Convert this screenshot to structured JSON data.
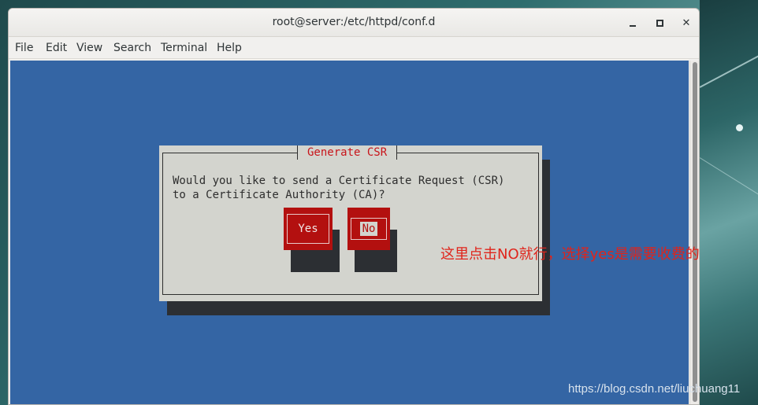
{
  "window": {
    "title": "root@server:/etc/httpd/conf.d",
    "controls": {
      "minimize": "minimize-icon",
      "maximize": "maximize-icon",
      "close": "close-icon"
    }
  },
  "menu": {
    "items": [
      "File",
      "Edit",
      "View",
      "Search",
      "Terminal",
      "Help"
    ]
  },
  "dialog": {
    "title": "Generate CSR",
    "line1": "Would you like to send a Certificate Request (CSR)",
    "line2": "to a Certificate Authority (CA)?",
    "yes_label": "Yes",
    "no_label": "No"
  },
  "annotation": "这里点击NO就行，选择yes是需要收费的",
  "watermark": "https://blog.csdn.net/liuchuang11",
  "colors": {
    "terminal_bg": "#3465a4",
    "dialog_bg": "#d3d4ce",
    "button_red": "#b3100f",
    "title_red": "#c8141a",
    "annotation_red": "#e0241b"
  }
}
